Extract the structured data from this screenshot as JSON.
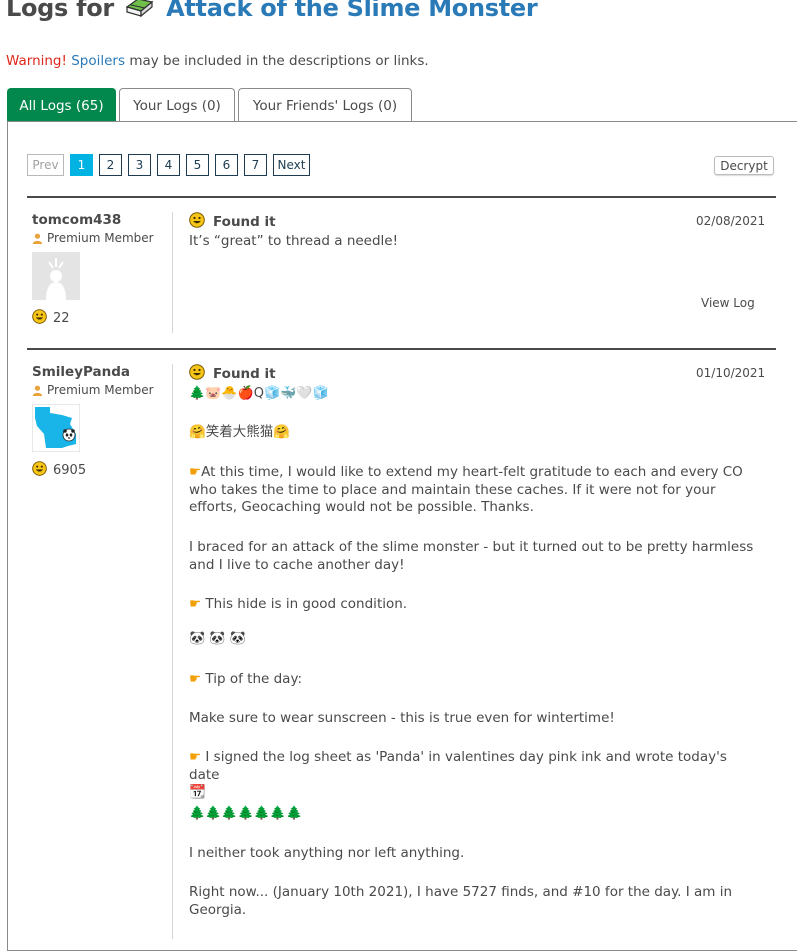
{
  "header": {
    "title_prefix": "Logs for",
    "cache_name": "Attack of the Slime Monster"
  },
  "warning": {
    "label": "Warning!",
    "link": "Spoilers",
    "rest": "may be included in the descriptions or links."
  },
  "tabs": [
    {
      "label": "All Logs (65)",
      "active": true
    },
    {
      "label": "Your Logs (0)",
      "active": false
    },
    {
      "label": "Your Friends' Logs (0)",
      "active": false
    }
  ],
  "pager": {
    "prev": "Prev",
    "pages": [
      "1",
      "2",
      "3",
      "4",
      "5",
      "6",
      "7"
    ],
    "current": "1",
    "next": "Next"
  },
  "decrypt_label": "Decrypt",
  "logs": [
    {
      "username": "tomcom438",
      "member_type": "Premium Member",
      "finds": "22",
      "log_type": "Found it",
      "date": "02/08/2021",
      "text": "It’s “great” to thread a needle!",
      "view_log": "View Log"
    },
    {
      "username": "SmileyPanda",
      "member_type": "Premium Member",
      "finds": "6905",
      "log_type": "Found it",
      "date": "01/10/2021",
      "emoji_line_1": "🌲🐷🐣🍎Q🧊🐳🤍🧊",
      "emoji_line_2": "🤗笑着大熊猫🤗",
      "p1": "At this time, I would like to extend my heart-felt gratitude to each and every CO who takes the time to place and maintain these caches. If it were not for your efforts, Geocaching would not be possible. Thanks.",
      "p2": "I braced for an attack of the slime monster - but it turned out to be pretty harmless and I live to cache another day!",
      "p3": "This hide is in good condition.",
      "pandas": "🐼 🐼 🐼",
      "p4": "Tip of the day:",
      "p5": "Make sure to wear sunscreen - this is true even for wintertime!",
      "p6": "I signed the log sheet as 'Panda' in valentines day pink ink and wrote today's date",
      "calendar": "📆",
      "trees": "🌲🌲🌲🌲🌲🌲🌲",
      "p7": "I neither took anything nor left anything.",
      "p8": "Right now... (January 10th 2021), I have 5727 finds, and #10 for the day.  I am in Georgia."
    }
  ],
  "colors": {
    "accent_green": "#02874d",
    "link_blue": "#2a7ab8",
    "warning_red": "#e0261b",
    "current_page": "#00b3e3"
  }
}
